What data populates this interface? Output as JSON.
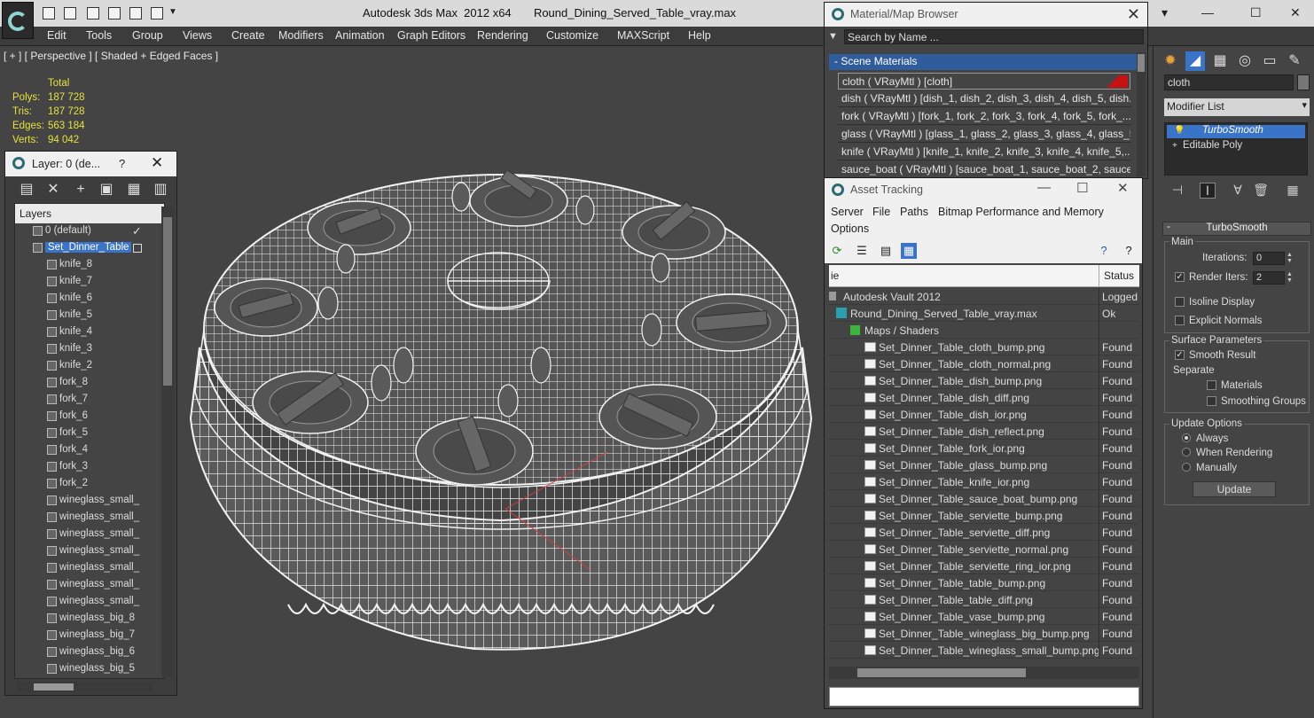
{
  "window": {
    "title": "Autodesk 3ds Max  2012 x64       Round_Dining_Served_Table_vray.max"
  },
  "menubar": [
    "Edit",
    "Tools",
    "Group",
    "Views",
    "Create",
    "Modifiers",
    "Animation",
    "Graph Editors",
    "Rendering",
    "Customize",
    "MAXScript",
    "Help"
  ],
  "viewport": {
    "label": "[ + ] [ Perspective ] [ Shaded + Edged Faces ]",
    "stats": {
      "header": "Total",
      "rows": [
        {
          "label": "Polys:",
          "value": "187 728"
        },
        {
          "label": "Tris:",
          "value": "187 728"
        },
        {
          "label": "Edges:",
          "value": "563 184"
        },
        {
          "label": "Verts:",
          "value": "94 042"
        }
      ]
    }
  },
  "layer_panel": {
    "title": "Layer: 0 (de...",
    "help": "?",
    "header": "Layers",
    "rows": [
      {
        "label": "0 (default)",
        "kind": "layer"
      },
      {
        "label": "Set_Dinner_Table",
        "kind": "layer-selected"
      },
      {
        "label": "knife_8",
        "kind": "object"
      },
      {
        "label": "knife_7",
        "kind": "object"
      },
      {
        "label": "knife_6",
        "kind": "object"
      },
      {
        "label": "knife_5",
        "kind": "object"
      },
      {
        "label": "knife_4",
        "kind": "object"
      },
      {
        "label": "knife_3",
        "kind": "object"
      },
      {
        "label": "knife_2",
        "kind": "object"
      },
      {
        "label": "fork_8",
        "kind": "object"
      },
      {
        "label": "fork_7",
        "kind": "object"
      },
      {
        "label": "fork_6",
        "kind": "object"
      },
      {
        "label": "fork_5",
        "kind": "object"
      },
      {
        "label": "fork_4",
        "kind": "object"
      },
      {
        "label": "fork_3",
        "kind": "object"
      },
      {
        "label": "fork_2",
        "kind": "object"
      },
      {
        "label": "wineglass_small_",
        "kind": "object"
      },
      {
        "label": "wineglass_small_",
        "kind": "object"
      },
      {
        "label": "wineglass_small_",
        "kind": "object"
      },
      {
        "label": "wineglass_small_",
        "kind": "object"
      },
      {
        "label": "wineglass_small_",
        "kind": "object"
      },
      {
        "label": "wineglass_small_",
        "kind": "object"
      },
      {
        "label": "wineglass_small_",
        "kind": "object"
      },
      {
        "label": "wineglass_big_8",
        "kind": "object"
      },
      {
        "label": "wineglass_big_7",
        "kind": "object"
      },
      {
        "label": "wineglass_big_6",
        "kind": "object"
      },
      {
        "label": "wineglass_big_5",
        "kind": "object"
      }
    ]
  },
  "material_browser": {
    "title": "Material/Map Browser",
    "search_placeholder": "Search by Name ...",
    "section": "- Scene Materials",
    "rows": [
      "cloth  ( VRayMtl )  [cloth]",
      "dish  ( VRayMtl )  [dish_1, dish_2, dish_3, dish_4, dish_5, dish...",
      "fork  ( VRayMtl )  [fork_1, fork_2, fork_3, fork_4, fork_5, fork_...",
      "glass  ( VRayMtl )  [glass_1, glass_2, glass_3, glass_4, glass_5...",
      "knife  ( VRayMtl )  [knife_1, knife_2, knife_3, knife_4, knife_5,...",
      "sauce_boat  ( VRayMtl )  [sauce_boat_1, sauce_boat_2, sauce..."
    ]
  },
  "asset_tracking": {
    "title": "Asset Tracking",
    "menu": [
      "Server",
      "File",
      "Paths",
      "Bitmap Performance and Memory",
      "Options"
    ],
    "col_name": "ie",
    "col_status": "Status",
    "rows": [
      {
        "name": "Autodesk Vault 2012",
        "status": "Logged",
        "icon": "vault",
        "indent": 0
      },
      {
        "name": "Round_Dining_Served_Table_vray.max",
        "status": "Ok",
        "icon": "max",
        "indent": 1
      },
      {
        "name": "Maps / Shaders",
        "status": "",
        "icon": "maps",
        "indent": 2
      },
      {
        "name": "Set_Dinner_Table_cloth_bump.png",
        "status": "Found",
        "icon": "png",
        "indent": 3
      },
      {
        "name": "Set_Dinner_Table_cloth_normal.png",
        "status": "Found",
        "icon": "png",
        "indent": 3
      },
      {
        "name": "Set_Dinner_Table_dish_bump.png",
        "status": "Found",
        "icon": "png",
        "indent": 3
      },
      {
        "name": "Set_Dinner_Table_dish_diff.png",
        "status": "Found",
        "icon": "png",
        "indent": 3
      },
      {
        "name": "Set_Dinner_Table_dish_ior.png",
        "status": "Found",
        "icon": "png",
        "indent": 3
      },
      {
        "name": "Set_Dinner_Table_dish_reflect.png",
        "status": "Found",
        "icon": "png",
        "indent": 3
      },
      {
        "name": "Set_Dinner_Table_fork_ior.png",
        "status": "Found",
        "icon": "png",
        "indent": 3
      },
      {
        "name": "Set_Dinner_Table_glass_bump.png",
        "status": "Found",
        "icon": "png",
        "indent": 3
      },
      {
        "name": "Set_Dinner_Table_knife_ior.png",
        "status": "Found",
        "icon": "png",
        "indent": 3
      },
      {
        "name": "Set_Dinner_Table_sauce_boat_bump.png",
        "status": "Found",
        "icon": "png",
        "indent": 3
      },
      {
        "name": "Set_Dinner_Table_serviette_bump.png",
        "status": "Found",
        "icon": "png",
        "indent": 3
      },
      {
        "name": "Set_Dinner_Table_serviette_diff.png",
        "status": "Found",
        "icon": "png",
        "indent": 3
      },
      {
        "name": "Set_Dinner_Table_serviette_normal.png",
        "status": "Found",
        "icon": "png",
        "indent": 3
      },
      {
        "name": "Set_Dinner_Table_serviette_ring_ior.png",
        "status": "Found",
        "icon": "png",
        "indent": 3
      },
      {
        "name": "Set_Dinner_Table_table_bump.png",
        "status": "Found",
        "icon": "png",
        "indent": 3
      },
      {
        "name": "Set_Dinner_Table_table_diff.png",
        "status": "Found",
        "icon": "png",
        "indent": 3
      },
      {
        "name": "Set_Dinner_Table_vase_bump.png",
        "status": "Found",
        "icon": "png",
        "indent": 3
      },
      {
        "name": "Set_Dinner_Table_wineglass_big_bump.png",
        "status": "Found",
        "icon": "png",
        "indent": 3
      },
      {
        "name": "Set_Dinner_Table_wineglass_small_bump.png",
        "status": "Found",
        "icon": "png",
        "indent": 3
      }
    ]
  },
  "command_panel": {
    "object_name": "cloth",
    "modifier_list": "Modifier List",
    "stack": [
      "TurboSmooth",
      "Editable Poly"
    ],
    "rollout_title": "TurboSmooth",
    "main_label": "Main",
    "iterations_label": "Iterations:",
    "iterations_value": "0",
    "render_iters_label": "Render Iters:",
    "render_iters_value": "2",
    "isoline_label": "Isoline Display",
    "explicit_label": "Explicit Normals",
    "surface_label": "Surface Parameters",
    "smooth_result_label": "Smooth Result",
    "separate_label": "Separate",
    "materials_label": "Materials",
    "smoothing_groups_label": "Smoothing Groups",
    "update_options_label": "Update Options",
    "always_label": "Always",
    "when_rendering_label": "When Rendering",
    "manually_label": "Manually",
    "update_button": "Update"
  },
  "colors": {
    "stats_yellow": "#e6e23a",
    "selection_blue": "#3a74c9",
    "wire_white": "#f2f2f2"
  }
}
